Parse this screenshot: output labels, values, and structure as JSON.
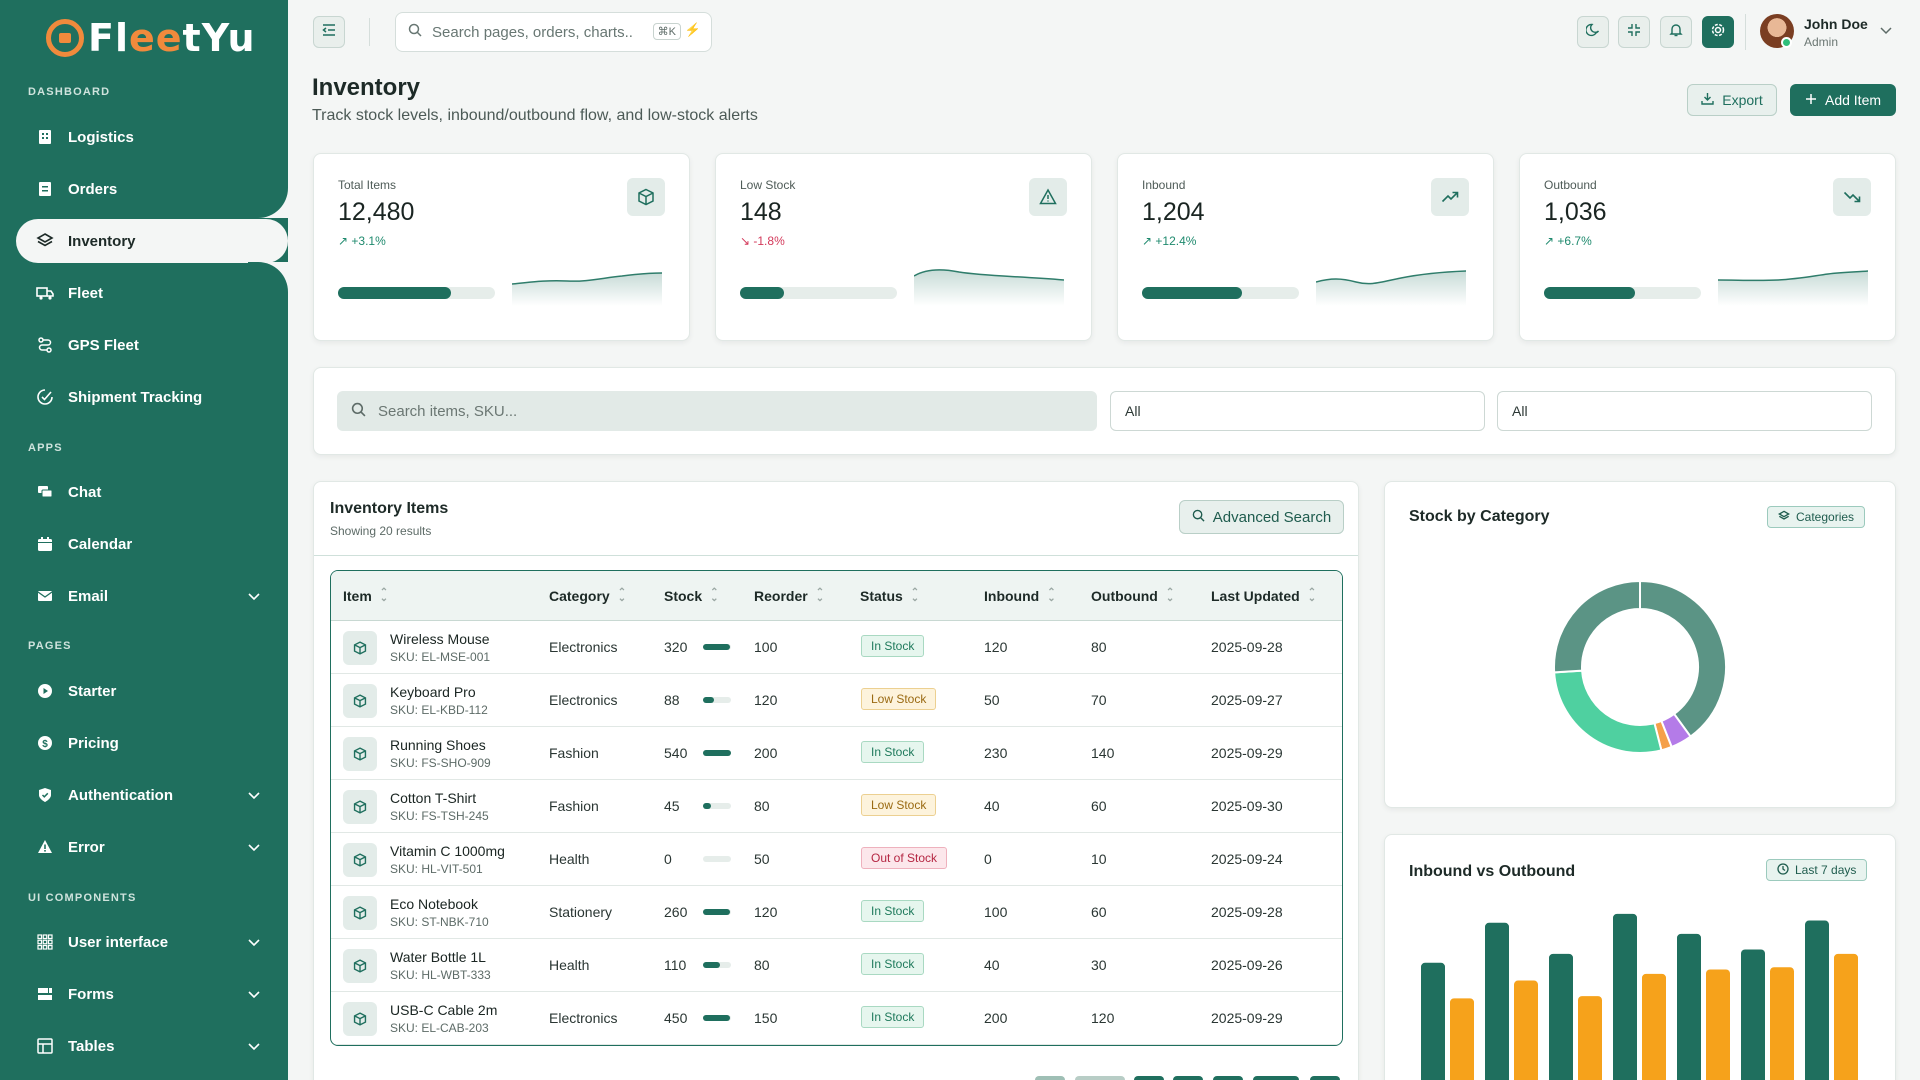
{
  "app": {
    "name_a": "Fl",
    "name_b": "ee",
    "name_c": "tYu"
  },
  "sidebar": {
    "sections": [
      {
        "label": "DASHBOARD"
      },
      {
        "label": "APPS"
      },
      {
        "label": "PAGES"
      },
      {
        "label": "UI COMPONENTS"
      }
    ],
    "items": [
      {
        "label": "Logistics",
        "icon": "building-icon"
      },
      {
        "label": "Orders",
        "icon": "receipt-icon"
      },
      {
        "label": "Inventory",
        "icon": "layers-icon"
      },
      {
        "label": "Fleet",
        "icon": "truck-icon"
      },
      {
        "label": "GPS Fleet",
        "icon": "route-icon"
      },
      {
        "label": "Shipment Tracking",
        "icon": "tracking-icon"
      },
      {
        "label": "Chat",
        "icon": "chat-icon"
      },
      {
        "label": "Calendar",
        "icon": "calendar-icon"
      },
      {
        "label": "Email",
        "icon": "mail-icon"
      },
      {
        "label": "Starter",
        "icon": "play-icon"
      },
      {
        "label": "Pricing",
        "icon": "dollar-icon"
      },
      {
        "label": "Authentication",
        "icon": "shield-icon"
      },
      {
        "label": "Error",
        "icon": "warning-icon"
      },
      {
        "label": "User interface",
        "icon": "grid-icon"
      },
      {
        "label": "Forms",
        "icon": "form-icon"
      },
      {
        "label": "Tables",
        "icon": "table-icon"
      }
    ]
  },
  "topbar": {
    "search_placeholder": "Search pages, orders, charts..",
    "shortcut": "⌘K",
    "user_name": "John Doe",
    "user_role": "Admin"
  },
  "page": {
    "title": "Inventory",
    "subtitle": "Track stock levels, inbound/outbound flow, and low-stock alerts",
    "export_label": "Export",
    "add_label": "Add Item"
  },
  "stats": [
    {
      "label": "Total Items",
      "value": "12,480",
      "delta": "+3.1%",
      "trend": "up",
      "icon": "box-icon",
      "progress": 0.72
    },
    {
      "label": "Low Stock",
      "value": "148",
      "delta": "-1.8%",
      "trend": "down",
      "icon": "alert-triangle-icon",
      "progress": 0.28
    },
    {
      "label": "Inbound",
      "value": "1,204",
      "delta": "+12.4%",
      "trend": "up",
      "icon": "trending-up-icon",
      "progress": 0.64
    },
    {
      "label": "Outbound",
      "value": "1,036",
      "delta": "+6.7%",
      "trend": "up",
      "icon": "trending-down-icon",
      "progress": 0.58
    }
  ],
  "filters": {
    "search_placeholder": "Search items, SKU...",
    "category_value": "All",
    "status_value": "All"
  },
  "table": {
    "title": "Inventory Items",
    "subtitle": "Showing 20 results",
    "advanced_label": "Advanced Search",
    "columns": [
      "Item",
      "Category",
      "Stock",
      "Reorder",
      "Status",
      "Inbound",
      "Outbound",
      "Last Updated"
    ],
    "rows": [
      {
        "name": "Wireless Mouse",
        "sku": "SKU: EL-MSE-001",
        "category": "Electronics",
        "stock": "320",
        "stock_level": 0.95,
        "reorder": "100",
        "status": "In Stock",
        "inbound": "120",
        "outbound": "80",
        "updated": "2025-09-28"
      },
      {
        "name": "Keyboard Pro",
        "sku": "SKU: EL-KBD-112",
        "category": "Electronics",
        "stock": "88",
        "stock_level": 0.4,
        "reorder": "120",
        "status": "Low Stock",
        "inbound": "50",
        "outbound": "70",
        "updated": "2025-09-27"
      },
      {
        "name": "Running Shoes",
        "sku": "SKU: FS-SHO-909",
        "category": "Fashion",
        "stock": "540",
        "stock_level": 1.0,
        "reorder": "200",
        "status": "In Stock",
        "inbound": "230",
        "outbound": "140",
        "updated": "2025-09-29"
      },
      {
        "name": "Cotton T-Shirt",
        "sku": "SKU: FS-TSH-245",
        "category": "Fashion",
        "stock": "45",
        "stock_level": 0.3,
        "reorder": "80",
        "status": "Low Stock",
        "inbound": "40",
        "outbound": "60",
        "updated": "2025-09-30"
      },
      {
        "name": "Vitamin C 1000mg",
        "sku": "SKU: HL-VIT-501",
        "category": "Health",
        "stock": "0",
        "stock_level": 0.0,
        "reorder": "50",
        "status": "Out of Stock",
        "inbound": "0",
        "outbound": "10",
        "updated": "2025-09-24"
      },
      {
        "name": "Eco Notebook",
        "sku": "SKU: ST-NBK-710",
        "category": "Stationery",
        "stock": "260",
        "stock_level": 0.95,
        "reorder": "120",
        "status": "In Stock",
        "inbound": "100",
        "outbound": "60",
        "updated": "2025-09-28"
      },
      {
        "name": "Water Bottle 1L",
        "sku": "SKU: HL-WBT-333",
        "category": "Health",
        "stock": "110",
        "stock_level": 0.6,
        "reorder": "80",
        "status": "In Stock",
        "inbound": "40",
        "outbound": "30",
        "updated": "2025-09-26"
      },
      {
        "name": "USB-C Cable 2m",
        "sku": "SKU: EL-CAB-203",
        "category": "Electronics",
        "stock": "450",
        "stock_level": 0.95,
        "reorder": "150",
        "status": "In Stock",
        "inbound": "200",
        "outbound": "120",
        "updated": "2025-09-29"
      }
    ]
  },
  "category_card": {
    "title": "Stock by Category",
    "pill": "Categories",
    "slices": [
      {
        "value": 40,
        "color": "#5b9485"
      },
      {
        "value": 4,
        "color": "#b47be8"
      },
      {
        "value": 2,
        "color": "#f5a04a"
      },
      {
        "value": 28,
        "color": "#4fd0a0"
      },
      {
        "value": 26,
        "color": "#5b9485"
      }
    ]
  },
  "flow_card": {
    "title": "Inbound vs Outbound",
    "pill": "Last 7 days",
    "chart_data": {
      "type": "bar",
      "series": [
        {
          "values": [
            128,
            164,
            136,
            172,
            154,
            140,
            166
          ],
          "color": "#1f6f5e"
        },
        {
          "values": [
            96,
            112,
            98,
            118,
            122,
            124,
            136
          ],
          "color": "#f6a21b"
        }
      ]
    }
  }
}
